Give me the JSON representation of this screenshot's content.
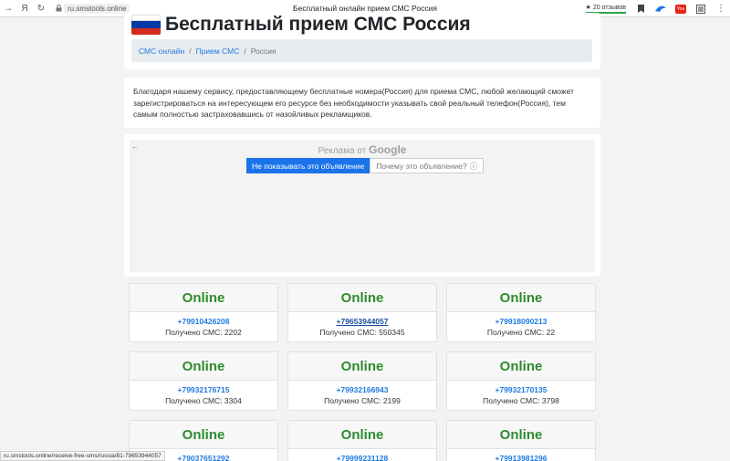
{
  "browser": {
    "url": "ru.smstools.online",
    "tab_title": "Бесплатный онлайн прием СМС Россия",
    "reviews": "20 отзывов",
    "yandex_glyph": "Я",
    "youtube_label": "You"
  },
  "header": {
    "title": "Бесплатный прием СМС Россия",
    "flag_colors": [
      "#ffffff",
      "#0039a6",
      "#d52b1e"
    ]
  },
  "breadcrumb": {
    "items": [
      "СМС онлайн",
      "Прием СМС"
    ],
    "current": "Россия",
    "separator": "/"
  },
  "description": "Благодаря нашему сервису, предоставляющему бесплатные номера(Россия) для приема СМС, любой желающий сможет зарегистрироваться на интересующем его ресурсе без необходимости указывать свой реальный телефон(Россия), тем самым полностью застраховавшись от назойливых рекламщиков.",
  "ad": {
    "label_prefix": "Реклама от",
    "label_brand": "Google",
    "hide_button": "Не показывать это объявление",
    "why_button": "Почему это объявление?"
  },
  "numbers": [
    {
      "status": "Online",
      "phone": "+79910426208",
      "received": "Получено СМС: 2202"
    },
    {
      "status": "Online",
      "phone": "+79653944057",
      "received": "Получено СМС: 550345"
    },
    {
      "status": "Online",
      "phone": "+79918090213",
      "received": "Получено СМС: 22"
    },
    {
      "status": "Online",
      "phone": "+79932176715",
      "received": "Получено СМС: 3304"
    },
    {
      "status": "Online",
      "phone": "+79932166943",
      "received": "Получено СМС: 2199"
    },
    {
      "status": "Online",
      "phone": "+79932170135",
      "received": "Получено СМС: 3798"
    },
    {
      "status": "Online",
      "phone": "+79037651292",
      "received": ""
    },
    {
      "status": "Online",
      "phone": "+79999231128",
      "received": ""
    },
    {
      "status": "Online",
      "phone": "+79913981296",
      "received": ""
    }
  ],
  "status_url": "ru.smstools.online/receive-free-sms/russia/81-79653944057",
  "colors": {
    "online_green": "#2e8b2e",
    "link_blue": "#1f7ae0",
    "ad_button_blue": "#1a73e8"
  }
}
